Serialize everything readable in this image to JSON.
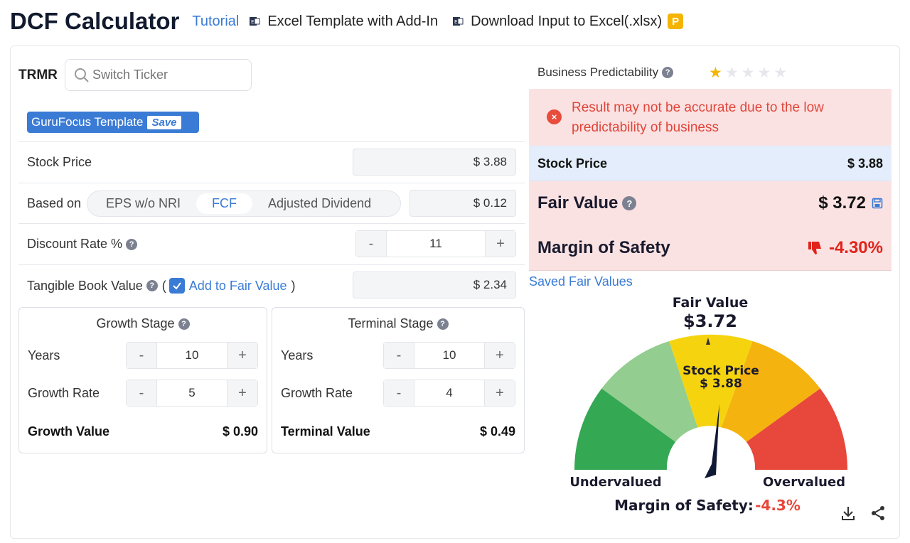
{
  "header": {
    "title": "DCF Calculator",
    "tutorial": "Tutorial",
    "excel_template": "Excel Template with Add-In",
    "download": "Download Input to Excel(.xlsx)",
    "premium_badge": "P"
  },
  "ticker": {
    "symbol": "TRMR",
    "search_placeholder": "Switch Ticker"
  },
  "template": {
    "label": "GuruFocus Template",
    "save": "Save"
  },
  "inputs": {
    "stock_price_label": "Stock Price",
    "stock_price_value": "$ 3.88",
    "based_on_label": "Based on",
    "based_on_options": [
      "EPS w/o NRI",
      "FCF",
      "Adjusted Dividend"
    ],
    "based_on_selected": "FCF",
    "based_on_value": "$ 0.12",
    "discount_rate_label": "Discount Rate %",
    "discount_rate_value": "11",
    "tbv_label": "Tangible Book Value",
    "tbv_paren_open": "(",
    "tbv_paren_close": ")",
    "tbv_checkbox_label": "Add to Fair Value",
    "tbv_checked": true,
    "tbv_value": "$ 2.34",
    "minus": "-",
    "plus": "+"
  },
  "growth_stage": {
    "title": "Growth Stage",
    "years_label": "Years",
    "years_value": "10",
    "rate_label": "Growth Rate",
    "rate_value": "5",
    "result_label": "Growth Value",
    "result_value": "$ 0.90"
  },
  "terminal_stage": {
    "title": "Terminal Stage",
    "years_label": "Years",
    "years_value": "10",
    "rate_label": "Growth Rate",
    "rate_value": "4",
    "result_label": "Terminal Value",
    "result_value": "$ 0.49"
  },
  "predictability": {
    "label": "Business Predictability",
    "stars": 1,
    "max_stars": 5,
    "warning": "Result may not be accurate due to the low predictability of business"
  },
  "result": {
    "stock_price_label": "Stock Price",
    "stock_price_value": "$ 3.88",
    "fair_value_label": "Fair Value",
    "fair_value_value": "$ 3.72",
    "mos_label": "Margin of Safety",
    "mos_value": "-4.30%"
  },
  "saved_link": "Saved Fair Values",
  "gauge": {
    "fair_value_label": "Fair Value",
    "fair_value": "$3.72",
    "stock_price_label": "Stock Price",
    "stock_price": "$ 3.88",
    "undervalued": "Undervalued",
    "overvalued": "Overvalued",
    "mos_label": "Margin of Safety:",
    "mos_value": "-4.3%"
  },
  "colors": {
    "accent": "#3a7bd5",
    "negative": "#e0231b",
    "warning_bg": "#fbe2e2",
    "gauge": [
      "#34a853",
      "#93cd8f",
      "#f5d40f",
      "#f5b30f",
      "#e8473b"
    ]
  },
  "icons": [
    "search-icon",
    "excel-icon",
    "question-icon",
    "check-icon",
    "error-icon",
    "star-icon",
    "save-disk-icon",
    "thumbs-down-icon",
    "download-icon",
    "share-icon"
  ]
}
